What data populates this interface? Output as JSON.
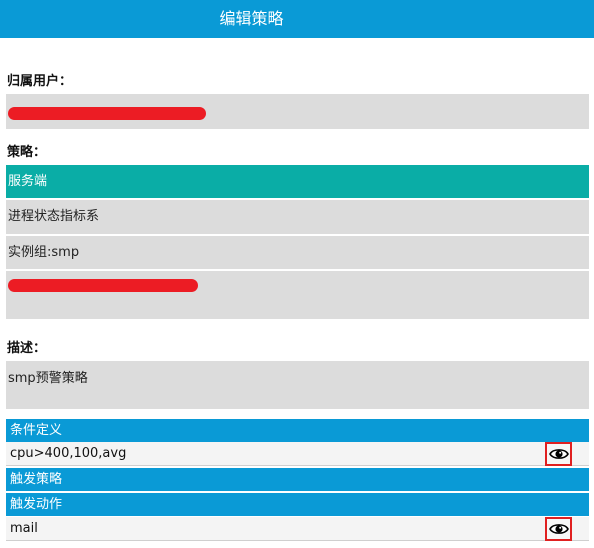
{
  "header": {
    "title": "编辑策略"
  },
  "owner": {
    "label": "归属用户："
  },
  "strategy": {
    "label": "策略：",
    "type": "服务端",
    "metric_system": "进程状态指标系",
    "instance_group": "实例组:smp"
  },
  "description": {
    "label": "描述：",
    "value": "smp预警策略"
  },
  "sections": {
    "condition_title": "条件定义",
    "condition_value": "cpu>400,100,avg",
    "trigger_policy_title": "触发策略",
    "trigger_action_title": "触发动作",
    "trigger_action_value": "mail"
  },
  "colors": {
    "header_blue": "#0a9ad6",
    "teal": "#0aada6",
    "field_gray": "#dcdcdc",
    "redaction_red": "#ec1c24",
    "highlight_red": "#e02020"
  },
  "icons": {
    "view": "eye-icon"
  }
}
